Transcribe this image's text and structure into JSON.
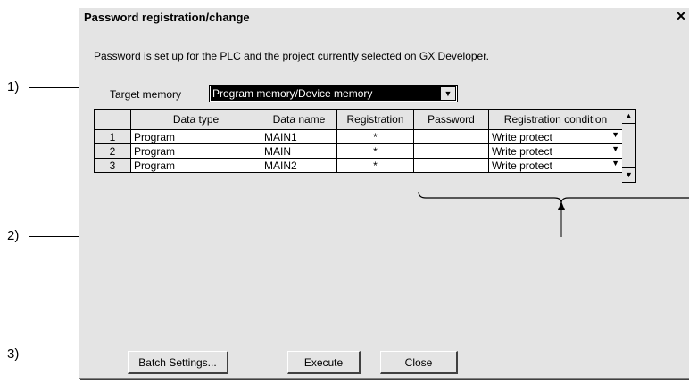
{
  "dialog": {
    "title": "Password registration/change",
    "close_glyph": "✕",
    "description": "Password is set up for the PLC and the project currently selected on GX Developer.",
    "target_memory_label": "Target memory",
    "target_memory_value": "Program memory/Device memory",
    "dropdown_glyph": "▼"
  },
  "table": {
    "columns": [
      "",
      "Data type",
      "Data name",
      "Registration",
      "Password",
      "Registration condition"
    ],
    "rows": [
      {
        "num": "1",
        "type": "Program",
        "name": "MAIN1",
        "reg": "*",
        "password": "",
        "condition": "Write protect"
      },
      {
        "num": "2",
        "type": "Program",
        "name": "MAIN",
        "reg": "*",
        "password": "",
        "condition": "Write protect"
      },
      {
        "num": "3",
        "type": "Program",
        "name": "MAIN2",
        "reg": "*",
        "password": "",
        "condition": "Write protect"
      }
    ]
  },
  "buttons": {
    "batch": "Batch Settings...",
    "execute": "Execute",
    "close": "Close"
  },
  "annotations": {
    "a1": "1)",
    "a2": "2)",
    "a3": "3)"
  }
}
